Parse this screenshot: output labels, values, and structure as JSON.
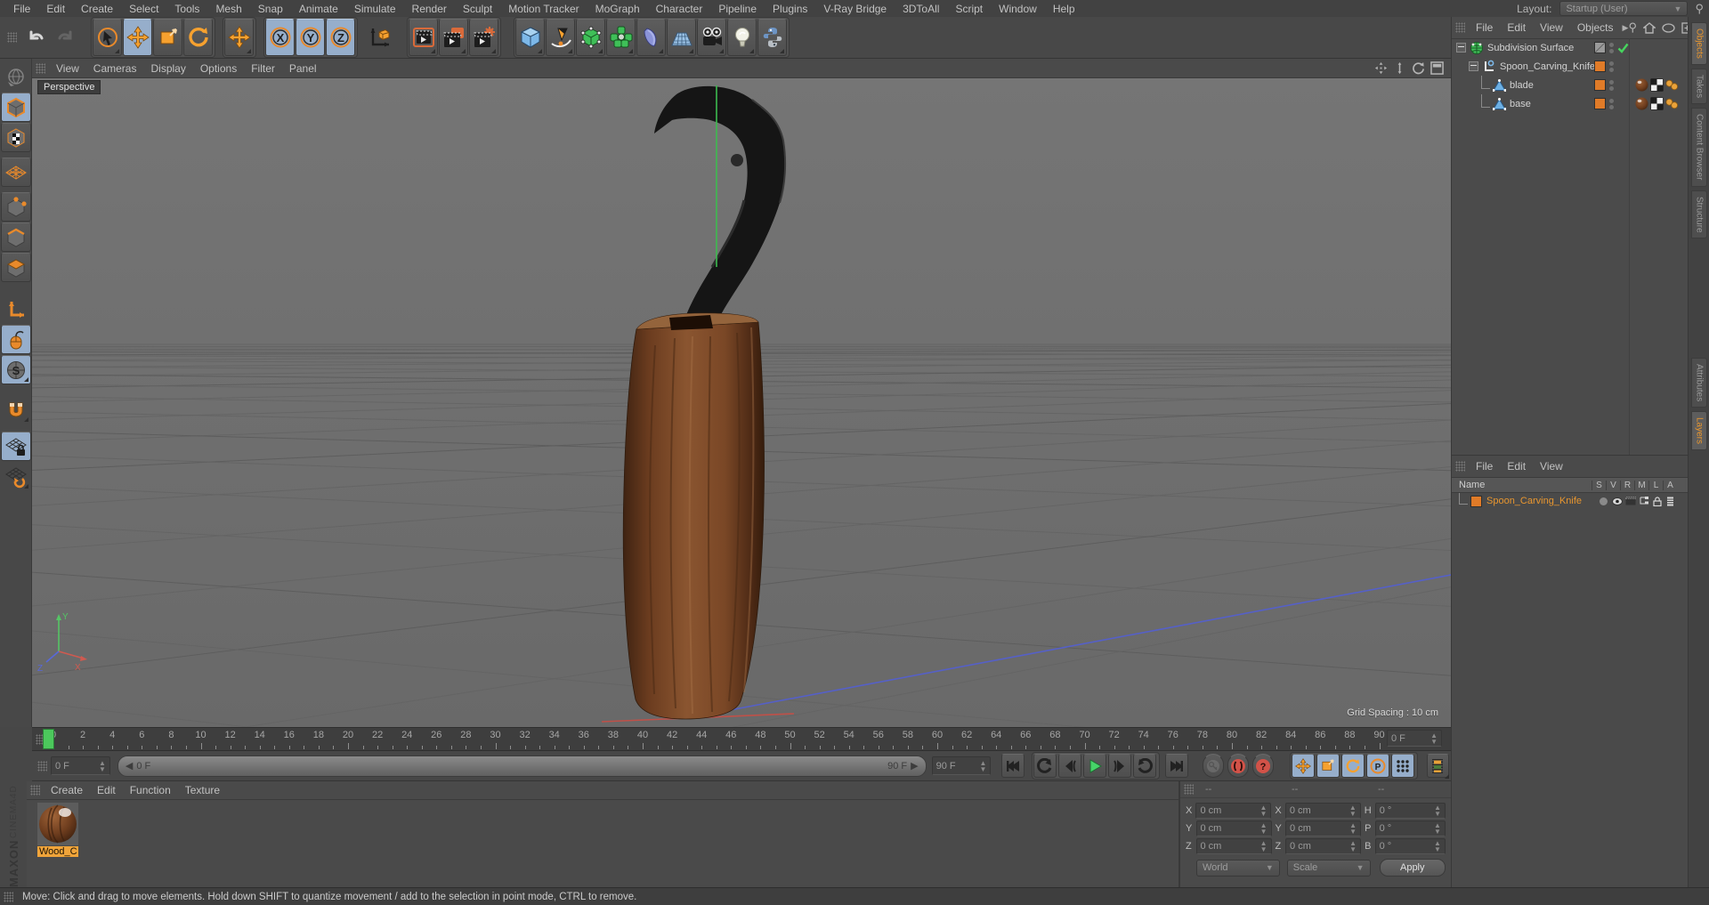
{
  "menubar": {
    "items": [
      "File",
      "Edit",
      "Create",
      "Select",
      "Tools",
      "Mesh",
      "Snap",
      "Animate",
      "Simulate",
      "Render",
      "Sculpt",
      "Motion Tracker",
      "MoGraph",
      "Character",
      "Pipeline",
      "Plugins",
      "V-Ray Bridge",
      "3DToAll",
      "Script",
      "Window",
      "Help"
    ],
    "layout_label": "Layout:",
    "layout_value": "Startup (User)"
  },
  "viewport": {
    "menu": [
      "View",
      "Cameras",
      "Display",
      "Options",
      "Filter",
      "Panel"
    ],
    "camera_label": "Perspective",
    "grid_spacing_label": "Grid Spacing : 10 cm",
    "axis_labels": {
      "x": "X",
      "y": "Y",
      "z": "Z"
    }
  },
  "object_manager": {
    "menu": [
      "File",
      "Edit",
      "View",
      "Objects"
    ],
    "side_tabs": [
      "Objects",
      "Takes",
      "Content Browser",
      "Structure"
    ],
    "tree": {
      "item0": "Subdivision Surface",
      "item1": "Spoon_Carving_Knife",
      "item2": "blade",
      "item3": "base"
    }
  },
  "layer_manager": {
    "menu": [
      "File",
      "Edit",
      "View"
    ],
    "name_column": "Name",
    "columns": [
      "S",
      "V",
      "R",
      "M",
      "L",
      "A"
    ],
    "row_name": "Spoon_Carving_Knife",
    "side_tabs": [
      "Attributes",
      "Layers"
    ]
  },
  "timeline": {
    "ticks": [
      0,
      2,
      4,
      6,
      8,
      10,
      12,
      14,
      16,
      18,
      20,
      22,
      24,
      26,
      28,
      30,
      32,
      34,
      36,
      38,
      40,
      42,
      44,
      46,
      48,
      50,
      52,
      54,
      56,
      58,
      60,
      62,
      64,
      66,
      68,
      70,
      72,
      74,
      76,
      78,
      80,
      82,
      84,
      86,
      88,
      90
    ],
    "current_frame_box": "0 F"
  },
  "transport": {
    "frame_start_value": "0 F",
    "slider_left_label": "0 F",
    "slider_right_label": "90 F",
    "frame_end_value": "90 F"
  },
  "materials": {
    "menu": [
      "Create",
      "Edit",
      "Function",
      "Texture"
    ],
    "material_name": "Wood_C"
  },
  "coordinates": {
    "headers": [
      "--",
      "--",
      "--"
    ],
    "position": {
      "x_label": "X",
      "x": "0 cm",
      "y_label": "Y",
      "y": "0 cm",
      "z_label": "Z",
      "z": "0 cm"
    },
    "scale": {
      "x_label": "X",
      "x": "0 cm",
      "y_label": "Y",
      "y": "0 cm",
      "z_label": "Z",
      "z": "0 cm"
    },
    "rotation": {
      "h_label": "H",
      "h": "0 °",
      "p_label": "P",
      "p": "0 °",
      "b_label": "B",
      "b": "0 °"
    },
    "space_dropdown": "World",
    "mode_dropdown": "Scale",
    "apply_label": "Apply"
  },
  "status": {
    "message": "Move: Click and drag to move elements. Hold down SHIFT to quantize movement / add to the selection in point mode, CTRL to remove."
  },
  "branding": {
    "line1": "MAXON",
    "line2": "CINEMA4D"
  },
  "colors": {
    "accent_orange": "#e98a2b",
    "active_blue": "#96aecb",
    "selection_green": "#43c45c",
    "record_red": "#c64a42",
    "material_label_orange": "#f0a43a",
    "viewport_grey": "#6f6f6f"
  }
}
